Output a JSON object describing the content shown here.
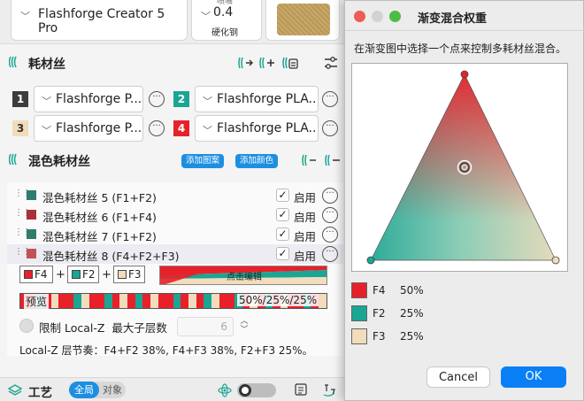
{
  "topbar": {
    "printer": "Flashforge Creator 5 Pro",
    "nozzle_cut": "喷嘴",
    "nozzle_value": "0.4",
    "nozzle_material": "硬化钢"
  },
  "filament_section": {
    "title": "耗材丝"
  },
  "filaments": [
    {
      "num": "1",
      "name": "Flashforge P...",
      "color": "#3c3c3c",
      "text_color": "#ffffff"
    },
    {
      "num": "2",
      "name": "Flashforge PLA...",
      "color": "#1aa594",
      "text_color": "#ffffff"
    },
    {
      "num": "3",
      "name": "Flashforge P...",
      "color": "#f1dcbc",
      "text_color": "#333333"
    },
    {
      "num": "4",
      "name": "Flashforge PLA...",
      "color": "#e8202a",
      "text_color": "#ffffff"
    }
  ],
  "mixed_section": {
    "title": "混色耗材丝",
    "add_pattern": "添加图案",
    "add_color": "添加颜色"
  },
  "mixed_items": [
    {
      "name": "混色耗材丝 5",
      "combo": "(F1+F2)",
      "color": "#2e7d6e",
      "enabled_label": "启用",
      "check": "✓"
    },
    {
      "name": "混色耗材丝 6",
      "combo": "(F1+F4)",
      "color": "#a8313a",
      "enabled_label": "启用",
      "check": "✓"
    },
    {
      "name": "混色耗材丝 7",
      "combo": "(F1+F2)",
      "color": "#2e7d6e",
      "enabled_label": "启用",
      "check": "✓"
    },
    {
      "name": "混色耗材丝 8",
      "combo": "(F4+F2+F3)",
      "color": "#c05454",
      "enabled_label": "启用",
      "check": "✓"
    }
  ],
  "editor": {
    "chips": [
      {
        "label": "F4",
        "color": "#e8202a"
      },
      {
        "label": "F2",
        "color": "#1aa594"
      },
      {
        "label": "F3",
        "color": "#f1dcbc"
      }
    ],
    "plus": "+",
    "edit_label": "点击编辑",
    "preview_label": "预览",
    "preview_pct": "50%/25%/25%",
    "preview_pattern": [
      "#e8202a",
      "#e8202a",
      "#1aa594",
      "#e8202a",
      "#f1dcbc",
      "#e8202a",
      "#e8202a",
      "#1aa594",
      "#f1dcbc",
      "#e8202a",
      "#e8202a",
      "#1aa594",
      "#e8202a",
      "#f1dcbc",
      "#e8202a",
      "#1aa594",
      "#e8202a",
      "#f1dcbc",
      "#e8202a",
      "#e8202a",
      "#1aa594",
      "#e8202a",
      "#f1dcbc",
      "#e8202a",
      "#1aa594",
      "#f1dcbc",
      "#e8202a",
      "#e8202a",
      "#1aa594",
      "#e8202a",
      "#f1dcbc",
      "#e8202a",
      "#1aa594",
      "#e8202a",
      "#f1dcbc",
      "#e8202a",
      "#e8202a",
      "#1aa594",
      "#e8202a",
      "#f1dcbc"
    ]
  },
  "localz": {
    "label": "限制 Local-Z",
    "max_label": "最大子层数",
    "max_value": "6",
    "summary": "Local-Z 层节奏：F4+F2 38%, F4+F3 38%, F2+F3 25%。"
  },
  "bottombar": {
    "title": "工艺",
    "seg_global": "全局",
    "seg_object": "对象"
  },
  "dialog": {
    "title": "渐变混合权重",
    "description": "在渐变图中选择一个点来控制多耗材丝混合。",
    "weights": [
      {
        "name": "F4",
        "percent": "50%",
        "value": 50,
        "color": "#e8202a"
      },
      {
        "name": "F2",
        "percent": "25%",
        "value": 25,
        "color": "#1aa594"
      },
      {
        "name": "F3",
        "percent": "25%",
        "value": 25,
        "color": "#f1dcbc"
      }
    ],
    "cancel": "Cancel",
    "ok": "OK",
    "traffic_colors": [
      "#ee5b54",
      "#d2d2d2",
      "#4bbd45"
    ]
  }
}
